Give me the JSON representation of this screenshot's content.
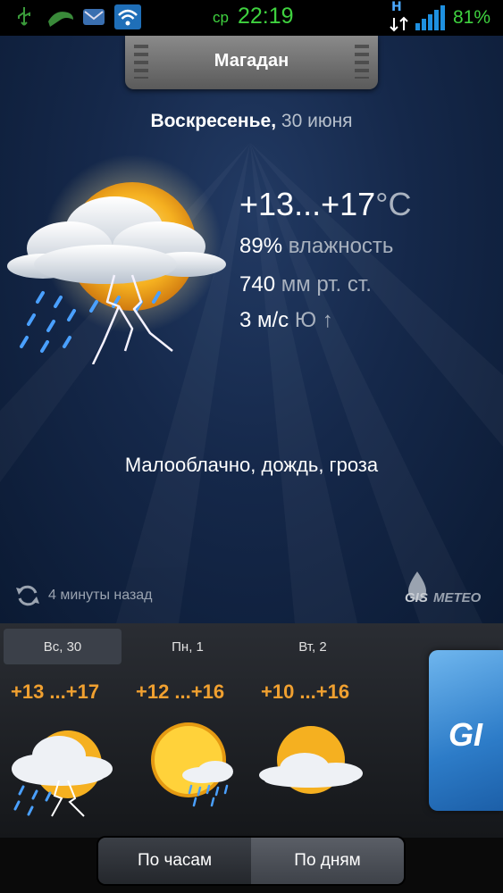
{
  "status_bar": {
    "day": "ср",
    "time": "22:19",
    "network": "H",
    "battery": "81%"
  },
  "city": "Магадан",
  "date": {
    "weekday": "Воскресенье,",
    "day_month": "30 июня"
  },
  "current": {
    "temperature": "+13...+17",
    "unit": "°C",
    "humidity_value": "89%",
    "humidity_label": "влажность",
    "pressure_value": "740",
    "pressure_unit": "мм рт. ст.",
    "wind_speed": "3 м/с",
    "wind_dir": "Ю",
    "wind_arrow": "↑",
    "condition": "Малооблачно,  дождь,  гроза"
  },
  "updated": "4 минуты назад",
  "logo": {
    "left": "GIS",
    "right": "METEO"
  },
  "forecast": [
    {
      "label": "Вс, 30",
      "temp": "+13 ...+17",
      "icon": "storm-icon",
      "active": true
    },
    {
      "label": "Пн, 1",
      "temp": "+12 ...+16",
      "icon": "sun-rain-icon",
      "active": false
    },
    {
      "label": "Вт, 2",
      "temp": "+10 ...+16",
      "icon": "partly-cloudy-icon",
      "active": false
    }
  ],
  "ad_text": "GI",
  "view_toggle": {
    "hourly": "По часам",
    "daily": "По дням",
    "selected": "hourly"
  },
  "colors": {
    "accent_orange": "#f0a030",
    "status_green": "#3fd23f",
    "background": "#15284a"
  }
}
